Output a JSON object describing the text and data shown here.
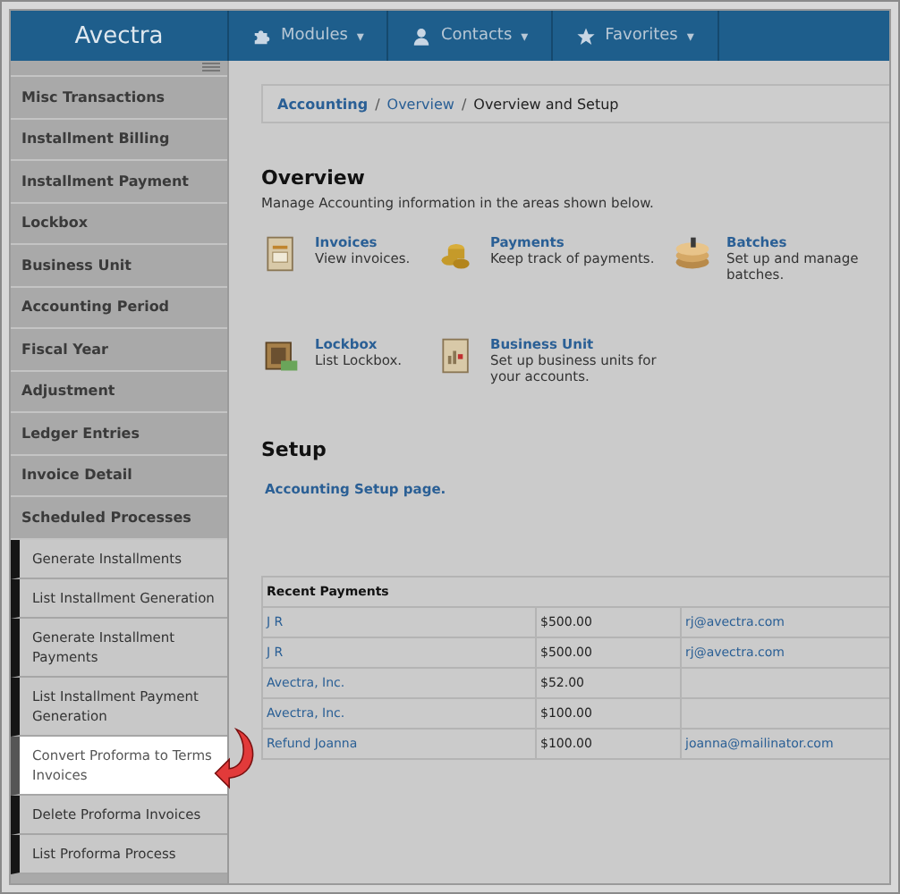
{
  "header": {
    "logo": "Avectra",
    "nav": [
      {
        "label": "Modules",
        "caret": "▾"
      },
      {
        "label": "Contacts",
        "caret": "▾"
      },
      {
        "label": "Favorites",
        "caret": "▾"
      }
    ]
  },
  "sidebar": {
    "items": [
      {
        "label": "Misc Transactions",
        "selected": false
      },
      {
        "label": "Installment Billing",
        "selected": false
      },
      {
        "label": "Installment Payment",
        "selected": false
      },
      {
        "label": "Lockbox",
        "selected": false
      },
      {
        "label": "Business Unit",
        "selected": false
      },
      {
        "label": "Accounting Period",
        "selected": false
      },
      {
        "label": "Fiscal Year",
        "selected": false
      },
      {
        "label": "Adjustment",
        "selected": false
      },
      {
        "label": "Ledger Entries",
        "selected": false
      },
      {
        "label": "Invoice Detail",
        "selected": false
      },
      {
        "label": "Scheduled Processes",
        "selected": false,
        "children": [
          {
            "label": "Generate Installments",
            "selected": false
          },
          {
            "label": "List Installment Generation",
            "selected": false
          },
          {
            "label": "Generate Installment Payments",
            "selected": false
          },
          {
            "label": "List Installment Payment Generation",
            "selected": false
          },
          {
            "label": "Convert Proforma to Terms Invoices",
            "selected": true
          },
          {
            "label": "Delete Proforma Invoices",
            "selected": false
          },
          {
            "label": "List Proforma Process",
            "selected": false
          }
        ]
      }
    ]
  },
  "breadcrumb": [
    {
      "label": "Accounting",
      "kind": "link"
    },
    {
      "separator": "/",
      "label": "Overview",
      "kind": "link"
    },
    {
      "separator": "/",
      "label": "Overview and Setup",
      "kind": "current"
    }
  ],
  "overview": {
    "title": "Overview",
    "description": "Manage Accounting information in the areas shown below.",
    "items": [
      {
        "title": "Invoices",
        "description": "View invoices."
      },
      {
        "title": "Payments",
        "description": "Keep track of payments."
      },
      {
        "title": "Batches",
        "description": "Set up and manage batches."
      },
      {
        "title": "Lockbox",
        "description": "List Lockbox."
      },
      {
        "title": "Business Unit",
        "description": "Set up business units for your accounts."
      }
    ]
  },
  "setup": {
    "title": "Setup",
    "link": "Accounting Setup page."
  },
  "recent_payments": {
    "title": "Recent Payments",
    "rows": [
      {
        "name": "J R",
        "amount": "$500.00",
        "email": "rj@avectra.com"
      },
      {
        "name": "J R",
        "amount": "$500.00",
        "email": "rj@avectra.com"
      },
      {
        "name": "Avectra, Inc.",
        "amount": "$52.00"
      },
      {
        "name": "Avectra, Inc.",
        "amount": "$100.00"
      },
      {
        "name": "Refund Joanna",
        "amount": "$100.00",
        "email": "joanna@mailinator.com"
      }
    ]
  }
}
